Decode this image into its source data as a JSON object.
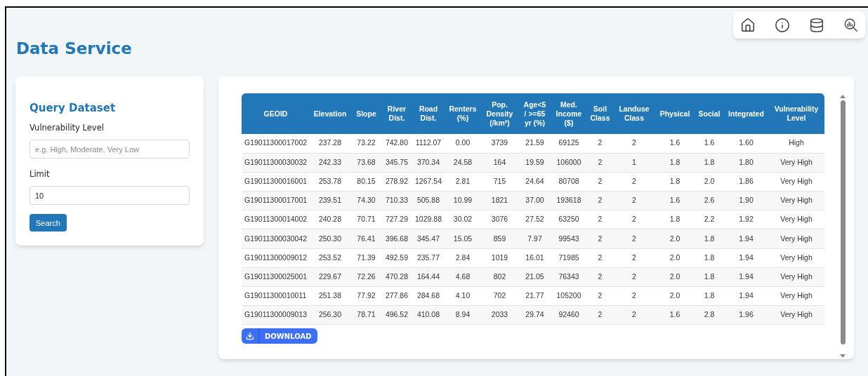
{
  "page_title": "Data Service",
  "nav_icons": [
    {
      "kind": "home"
    },
    {
      "kind": "info"
    },
    {
      "kind": "database"
    },
    {
      "kind": "analytics"
    }
  ],
  "query_panel": {
    "title": "Query Dataset",
    "fields": [
      {
        "label": "Vulnerability Level",
        "placeholder": "e.g. High, Moderate, Very Low"
      },
      {
        "label": "Limit",
        "value": "10"
      }
    ],
    "button": "Search"
  },
  "table": {
    "columns": [
      "GEOID",
      "Elevation",
      "Slope",
      "River\nDist.",
      "Road\nDist.",
      "Renters\n(%)",
      "Pop.\nDensity\n(/km²)",
      "Age<5\n/ >=65\nyr (%)",
      "Med.\nIncome\n($)",
      "Soil\nClass",
      "Landuse\nClass",
      "Physical",
      "Social",
      "Integrated",
      "Vulnerability\nLevel"
    ],
    "rows": [
      [
        "G19011300017002",
        "237.28",
        "73.22",
        "742.80",
        "1112.07",
        "0.00",
        "3739",
        "21.59",
        "69125",
        "2",
        "2",
        "1.6",
        "1.6",
        "1.60",
        "High"
      ],
      [
        "G19011300030032",
        "242.33",
        "73.68",
        "345.75",
        "370.34",
        "24.58",
        "164",
        "19.59",
        "106000",
        "2",
        "1",
        "1.8",
        "1.8",
        "1.80",
        "Very High"
      ],
      [
        "G19011300016001",
        "253.78",
        "80.15",
        "278.92",
        "1267.54",
        "2.81",
        "715",
        "24.64",
        "80708",
        "2",
        "2",
        "1.8",
        "2.0",
        "1.86",
        "Very High"
      ],
      [
        "G19011300017001",
        "239.51",
        "74.30",
        "710.33",
        "505.88",
        "10.99",
        "1821",
        "37.00",
        "193618",
        "2",
        "2",
        "1.6",
        "2.6",
        "1.90",
        "Very High"
      ],
      [
        "G19011300014002",
        "240.28",
        "70.71",
        "727.29",
        "1029.88",
        "30.02",
        "3076",
        "27.52",
        "63250",
        "2",
        "2",
        "1.8",
        "2.2",
        "1.92",
        "Very High"
      ],
      [
        "G19011300030042",
        "250.30",
        "76.41",
        "396.68",
        "345.47",
        "15.05",
        "859",
        "7.97",
        "99543",
        "2",
        "2",
        "2.0",
        "1.8",
        "1.94",
        "Very High"
      ],
      [
        "G19011300009012",
        "253.52",
        "71.39",
        "492.59",
        "235.77",
        "2.84",
        "1019",
        "16.01",
        "71985",
        "2",
        "2",
        "2.0",
        "1.8",
        "1.94",
        "Very High"
      ],
      [
        "G19011300025001",
        "229.67",
        "72.26",
        "470.28",
        "164.44",
        "4.68",
        "802",
        "21.05",
        "76343",
        "2",
        "2",
        "2.0",
        "1.8",
        "1.94",
        "Very High"
      ],
      [
        "G19011300010011",
        "251.38",
        "77.92",
        "277.86",
        "284.68",
        "4.10",
        "702",
        "21.77",
        "105200",
        "2",
        "2",
        "2.0",
        "1.8",
        "1.94",
        "Very High"
      ],
      [
        "G19011300009013",
        "256.30",
        "78.71",
        "496.52",
        "410.08",
        "8.94",
        "2033",
        "29.74",
        "92460",
        "2",
        "2",
        "1.6",
        "2.8",
        "1.96",
        "Very High"
      ]
    ]
  },
  "download_button": "DOWNLOAD"
}
